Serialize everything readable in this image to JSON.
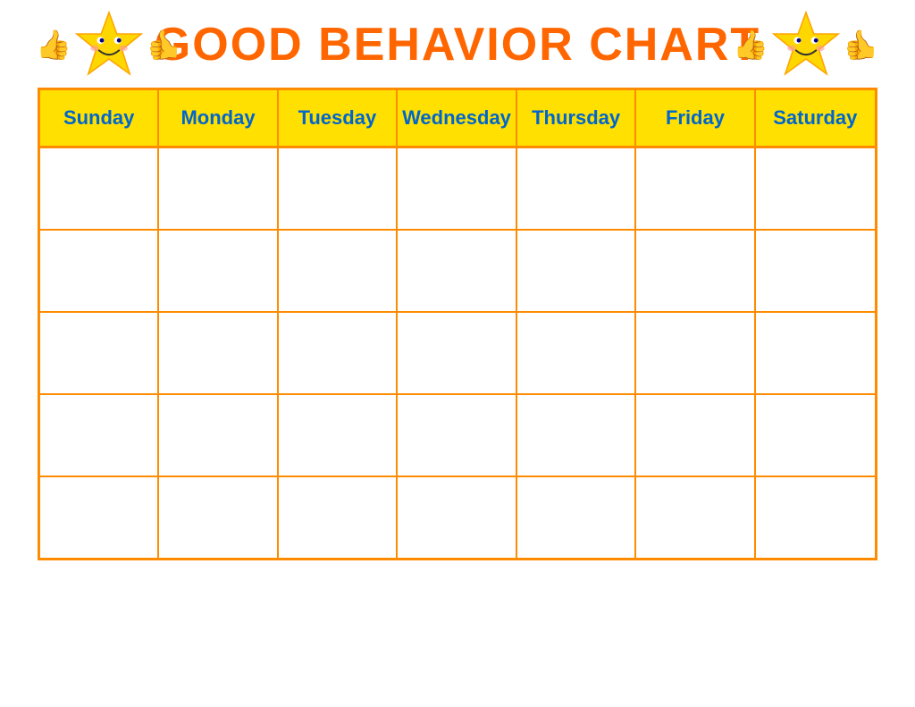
{
  "header": {
    "title": "GOOD BEHAVIOR CHART",
    "star_left_thumb1": "👍",
    "star_right_thumb1": "👍",
    "star_right_thumb2": "👍",
    "star_left_thumb2": "👍"
  },
  "chart": {
    "days": [
      {
        "label": "Sunday"
      },
      {
        "label": "Monday"
      },
      {
        "label": "Tuesday"
      },
      {
        "label": "Wednesday"
      },
      {
        "label": "Thursday"
      },
      {
        "label": "Friday"
      },
      {
        "label": "Saturday"
      }
    ],
    "rows": 5
  },
  "colors": {
    "title": "#FF6600",
    "header_bg": "#FFE000",
    "day_text": "#0066CC",
    "border": "#FF8C00",
    "cell_bg": "#ffffff"
  }
}
